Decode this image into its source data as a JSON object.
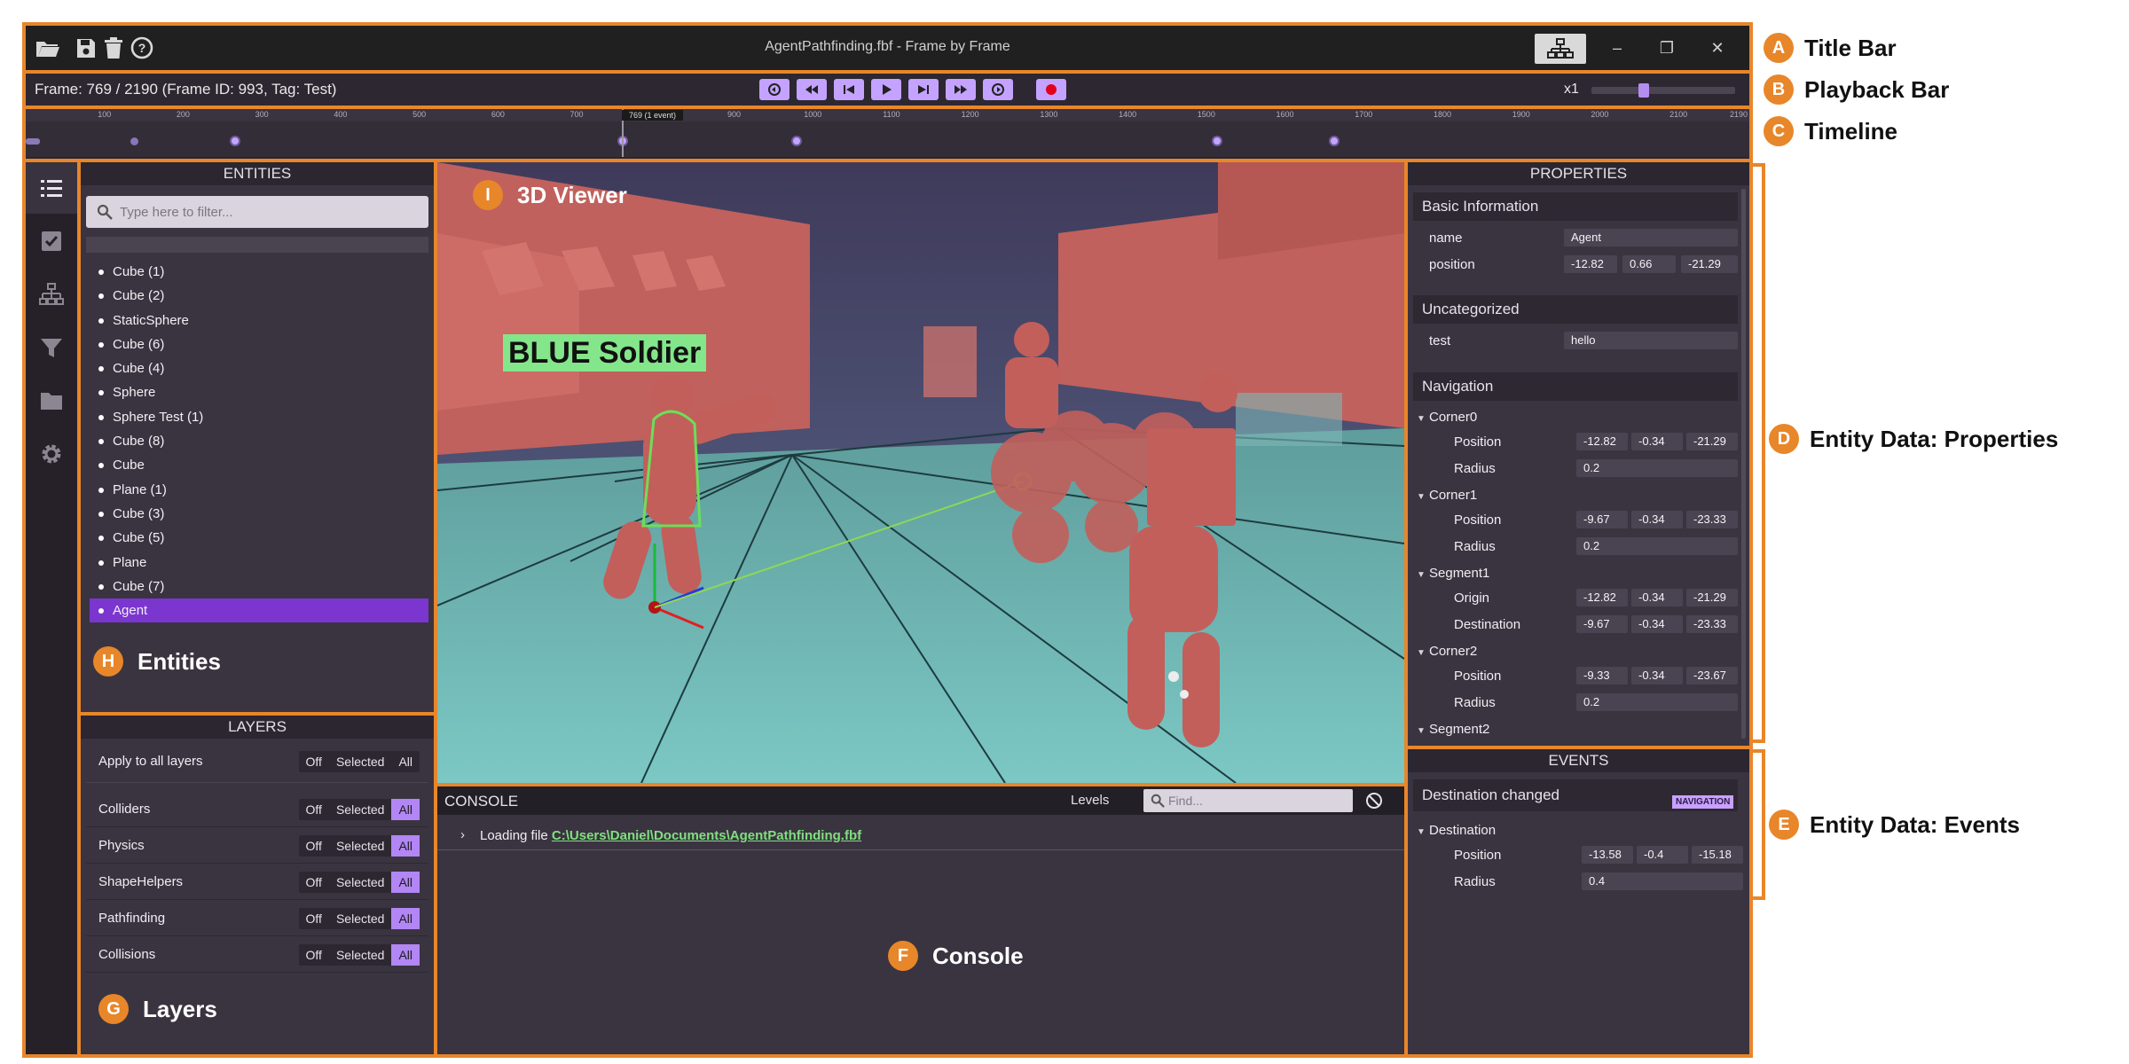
{
  "window": {
    "title": "AgentPathfinding.fbf - Frame by Frame",
    "toolbar_icons": [
      "folder-open-icon",
      "save-icon",
      "trash-icon",
      "help-icon"
    ],
    "graph_button_icon": "network-graph-icon",
    "controls": [
      "minimize",
      "restore",
      "close"
    ]
  },
  "playback": {
    "frame_info": "Frame: 769 / 2190 (Frame ID: 993, Tag: Test)",
    "buttons": [
      "previous-event",
      "rewind",
      "step-back",
      "play",
      "step-forward",
      "fast-forward",
      "next-event",
      "record"
    ],
    "speed": "x1",
    "speed_level": 0.35
  },
  "timeline": {
    "ticks": [
      "100",
      "200",
      "300",
      "400",
      "500",
      "600",
      "700",
      "800",
      "900",
      "1000",
      "1100",
      "1200",
      "1300",
      "1400",
      "1500",
      "1600",
      "1700",
      "1800",
      "1900",
      "2000",
      "2100",
      "2190"
    ],
    "tooltip": "769 (1 event)",
    "current_frame": 769,
    "total_frames": 2190
  },
  "sidebar": {
    "items": [
      "entity-list-icon",
      "checklist-icon",
      "hierarchy-icon",
      "filter-icon",
      "folder-icon",
      "settings-icon"
    ]
  },
  "entities": {
    "header": "ENTITIES",
    "filter_placeholder": "Type here to filter...",
    "items": [
      "Cube (1)",
      "Cube (2)",
      "StaticSphere",
      "Cube (6)",
      "Cube (4)",
      "Sphere",
      "Sphere Test (1)",
      "Cube (8)",
      "Cube",
      "Plane (1)",
      "Cube (3)",
      "Cube (5)",
      "Plane",
      "Cube (7)",
      "Agent"
    ],
    "selected_index": 14
  },
  "layers": {
    "header": "LAYERS",
    "apply_all": "Apply to all layers",
    "options": [
      "Off",
      "Selected",
      "All"
    ],
    "rows": [
      "Colliders",
      "Physics",
      "ShapeHelpers",
      "Pathfinding",
      "Collisions"
    ]
  },
  "viewer": {
    "label": "BLUE Soldier"
  },
  "console": {
    "header": "CONSOLE",
    "levels": "Levels",
    "find_placeholder": "Find...",
    "line_prefix": "Loading file ",
    "line_link": "C:\\Users\\Daniel\\Documents\\AgentPathfinding.fbf"
  },
  "properties": {
    "header": "PROPERTIES",
    "basic": {
      "title": "Basic Information",
      "name_key": "name",
      "name_val": "Agent",
      "pos_key": "position",
      "pos": [
        "-12.82",
        "0.66",
        "-21.29"
      ]
    },
    "uncat": {
      "title": "Uncategorized",
      "test_key": "test",
      "test_val": "hello"
    },
    "nav": {
      "title": "Navigation",
      "corner0": "Corner0",
      "corner1": "Corner1",
      "segment1": "Segment1",
      "corner2": "Corner2",
      "segment2": "Segment2",
      "position": "Position",
      "radius": "Radius",
      "origin": "Origin",
      "destination": "Destination",
      "c0_pos": [
        "-12.82",
        "-0.34",
        "-21.29"
      ],
      "c0_rad": "0.2",
      "c1_pos": [
        "-9.67",
        "-0.34",
        "-23.33"
      ],
      "c1_rad": "0.2",
      "s1_origin": [
        "-12.82",
        "-0.34",
        "-21.29"
      ],
      "s1_dest": [
        "-9.67",
        "-0.34",
        "-23.33"
      ],
      "c2_pos": [
        "-9.33",
        "-0.34",
        "-23.67"
      ],
      "c2_rad": "0.2"
    }
  },
  "events": {
    "header": "EVENTS",
    "event_name": "Destination changed",
    "tag": "NAVIGATION",
    "group": "Destination",
    "position": "Position",
    "radius": "Radius",
    "pos": [
      "-13.58",
      "-0.4",
      "-15.18"
    ],
    "rad": "0.4"
  },
  "callouts": {
    "A": "Title Bar",
    "B": "Playback Bar",
    "C": "Timeline",
    "D": "Entity Data: Properties",
    "E": "Entity Data: Events",
    "F": "Console",
    "G": "Layers",
    "H": "Entities",
    "I": "3D Viewer",
    "letters": [
      "A",
      "B",
      "C",
      "D",
      "E",
      "F",
      "G",
      "H",
      "I"
    ]
  },
  "colors": {
    "accent_orange": "#e8862a",
    "accent_purple": "#b286f4",
    "selected_item": "#7b36d0",
    "label_green": "#84e68a"
  }
}
